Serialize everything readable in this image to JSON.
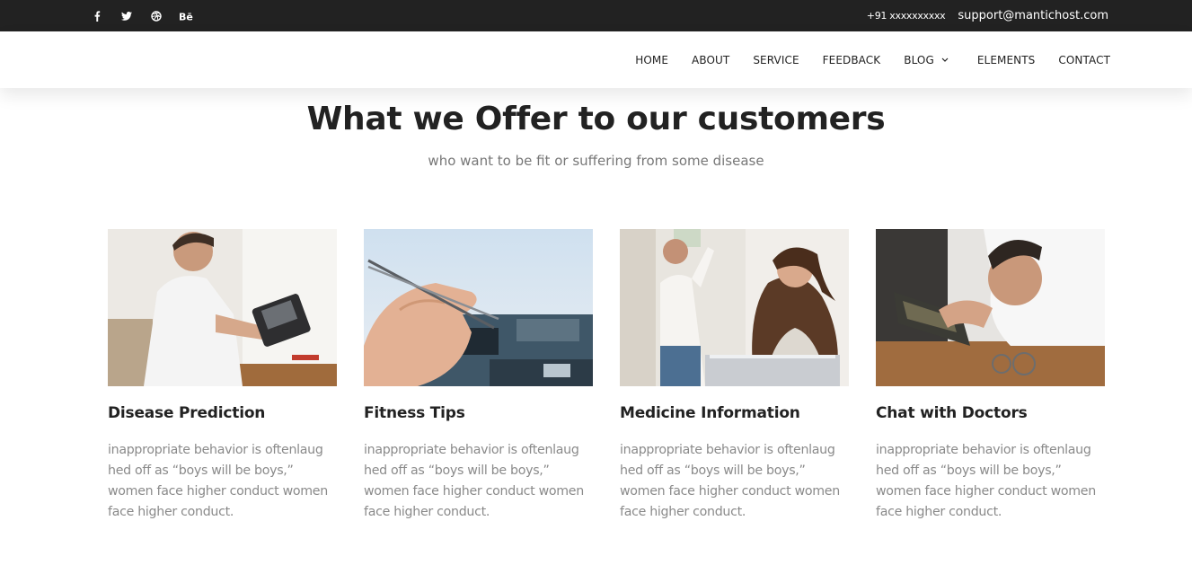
{
  "topbar": {
    "social_icons": [
      "facebook-icon",
      "twitter-icon",
      "dribbble-icon",
      "behance-icon"
    ],
    "phone": "+91 xxxxxxxxxx",
    "email": "support@mantichost.com"
  },
  "nav": {
    "items": [
      "HOME",
      "ABOUT",
      "SERVICE",
      "FEEDBACK",
      "BLOG",
      "ELEMENTS",
      "CONTACT"
    ]
  },
  "hero": {
    "title": "What we Offer to our customers",
    "subtitle": "who want to be fit or suffering from some disease"
  },
  "cards": [
    {
      "title": "Disease Prediction",
      "text": "inappropriate behavior is oftenlaug hed off as “boys will be boys,” women face higher conduct women face higher conduct."
    },
    {
      "title": "Fitness Tips",
      "text": "inappropriate behavior is oftenlaug hed off as “boys will be boys,” women face higher conduct women face higher conduct."
    },
    {
      "title": "Medicine Information",
      "text": "inappropriate behavior is oftenlaug hed off as “boys will be boys,” women face higher conduct women face higher conduct."
    },
    {
      "title": "Chat with Doctors",
      "text": "inappropriate behavior is oftenlaug hed off as “boys will be boys,” women face higher conduct women face higher conduct."
    }
  ],
  "colors": {
    "topbar_bg": "#222222",
    "heading": "#222222",
    "body_text": "#8a8a8a"
  }
}
